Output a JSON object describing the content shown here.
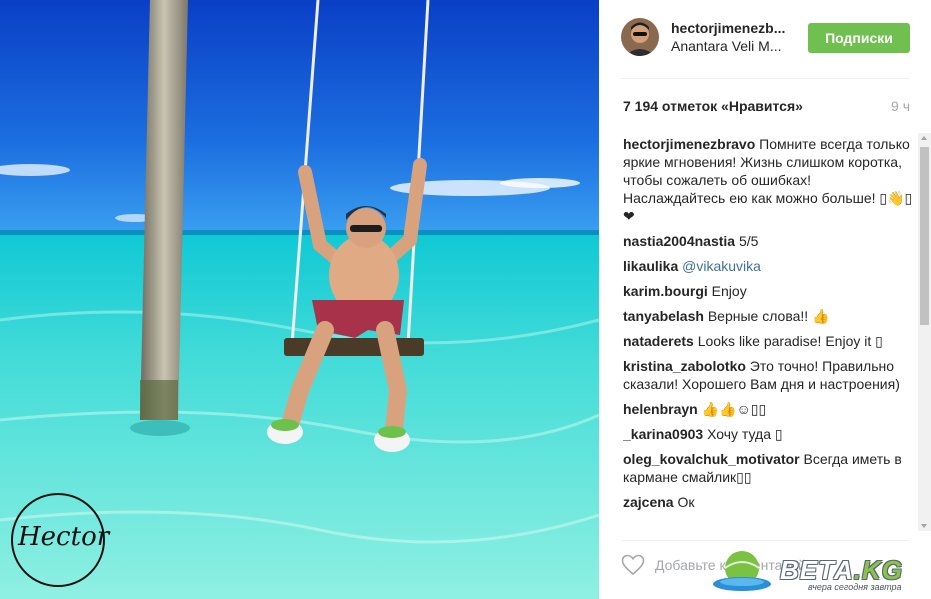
{
  "post": {
    "username": "hectorjimenezb...",
    "location": "Anantara Veli M...",
    "follow_label": "Подписки",
    "likes": "7 194 отметок «Нравится»",
    "time": "9 ч",
    "signature": "Hector"
  },
  "comments": [
    {
      "user": "hectorjimenezbravo",
      "text": " Помните всегда только яркие мгновения! Жизнь слишком коротка, чтобы сожалеть об ошибках! Наслаждайтесь ею как можно больше! ▯👋▯❤"
    },
    {
      "user": "nastia2004nastia",
      "text": " 5/5"
    },
    {
      "user": "likaulika",
      "mention": "@vikakuvika",
      "text": ""
    },
    {
      "user": "karim.bourgi",
      "text": " Enjoy"
    },
    {
      "user": "tanyabelash",
      "text": " Верные слова!! 👍"
    },
    {
      "user": "nataderets",
      "text": " Looks like paradise! Enjoy it ▯"
    },
    {
      "user": "kristina_zabolotko",
      "text": " Это точно! Правильно сказали! Хорошего Вам дня и настроения)"
    },
    {
      "user": "helenbrayn",
      "text": " 👍👍☺▯▯"
    },
    {
      "user": "_karina0903",
      "text": " Хочу туда ▯"
    },
    {
      "user": "oleg_kovalchuk_motivator",
      "text": " Всегда иметь в кармане смайлик▯▯"
    },
    {
      "user": "zajcena",
      "text": " Ок"
    }
  ],
  "footer": {
    "comment_placeholder": "Добавьте комментарий...",
    "heart_icon": "heart-outline-icon"
  },
  "watermark": {
    "brand_main": "ВЕТА",
    "brand_domain": ".KG",
    "tagline": "вчера сегодня завтра"
  },
  "colors": {
    "follow_green": "#70c050",
    "mention_blue": "#3f729b",
    "muted_gray": "#a5a7aa"
  }
}
